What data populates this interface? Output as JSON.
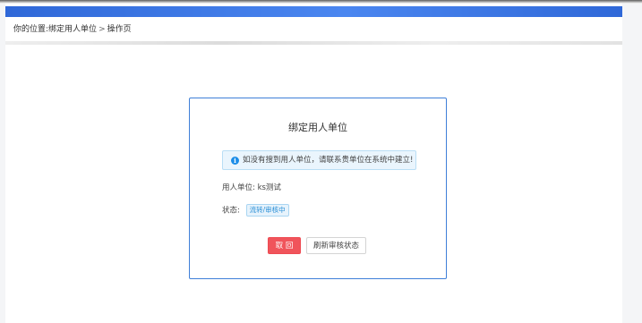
{
  "breadcrumb": {
    "prefix": "你的位置:",
    "parent": "绑定用人单位",
    "separator": ">",
    "current": "操作页"
  },
  "card": {
    "title": "绑定用人单位",
    "alert": {
      "icon": "info-icon",
      "text": "如没有搜到用人单位，请联系贵单位在系统中建立!"
    },
    "unit_label": "用人单位:",
    "unit_value": "ks测试",
    "status_label": "状态:",
    "status_value": "流转/审核中",
    "back_button": "取 回",
    "refresh_button": "刷新审核状态"
  },
  "colors": {
    "header_bar": "#2f68d8",
    "card_border": "#3f7fd8",
    "back_button": "#f0545b",
    "alert_bg": "#eaf5fd",
    "info_icon": "#1c8de8"
  }
}
